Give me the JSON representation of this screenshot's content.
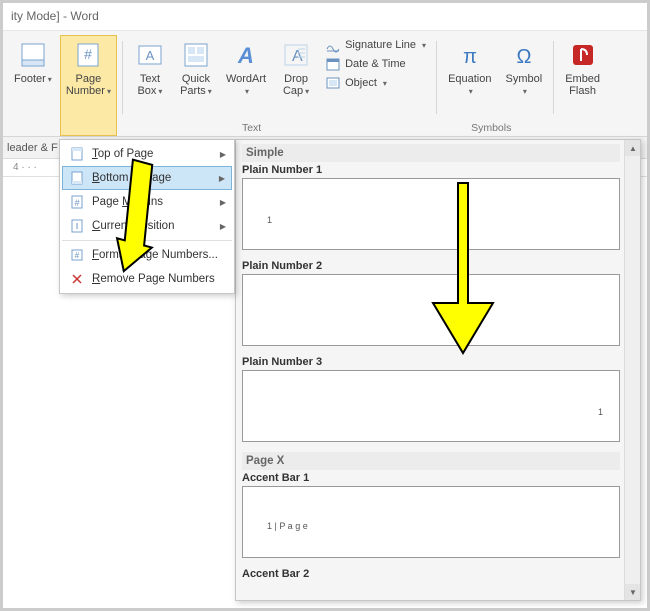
{
  "window": {
    "title": "ity Mode] - Word"
  },
  "ribbon": {
    "footer": "Footer",
    "pagenum": "Page\nNumber",
    "textbox": "Text\nBox",
    "quickparts": "Quick\nParts",
    "wordart": "WordArt",
    "dropcap": "Drop\nCap",
    "sigline": "Signature Line",
    "datetime": "Date & Time",
    "object": "Object",
    "equation": "Equation",
    "symbol": "Symbol",
    "embedflash": "Embed\nFlash",
    "group_text": "Text",
    "group_symbols": "Symbols"
  },
  "below": {
    "headerf": "leader & F",
    "ruler": "4 · · ·"
  },
  "submenu": {
    "top": "Top of Page",
    "bottom": "Bottom of Page",
    "margins": "Page Margins",
    "current": "Current Position",
    "format": "Format Page Numbers...",
    "remove": "Remove Page Numbers",
    "top_u": "T",
    "bottom_u": "B",
    "margins_u": "M",
    "current_u": "C",
    "format_u": "F",
    "remove_u": "R",
    "top_r": "op of Page",
    "bottom_r": "ottom of Page",
    "margins_r": "argins",
    "current_r": "urrent Position",
    "format_r": "ormat Page Numbers...",
    "remove_r": "emove Page Numbers",
    "page_pre": "Page "
  },
  "gallery": {
    "cat_simple": "Simple",
    "item1": "Plain Number 1",
    "item2": "Plain Number 2",
    "item3": "Plain Number 3",
    "cat_pagex": "Page X",
    "item4": "Accent Bar 1",
    "item5": "Accent Bar 2",
    "num1": "1",
    "num3": "1",
    "acc1": "1 | P a g e"
  }
}
